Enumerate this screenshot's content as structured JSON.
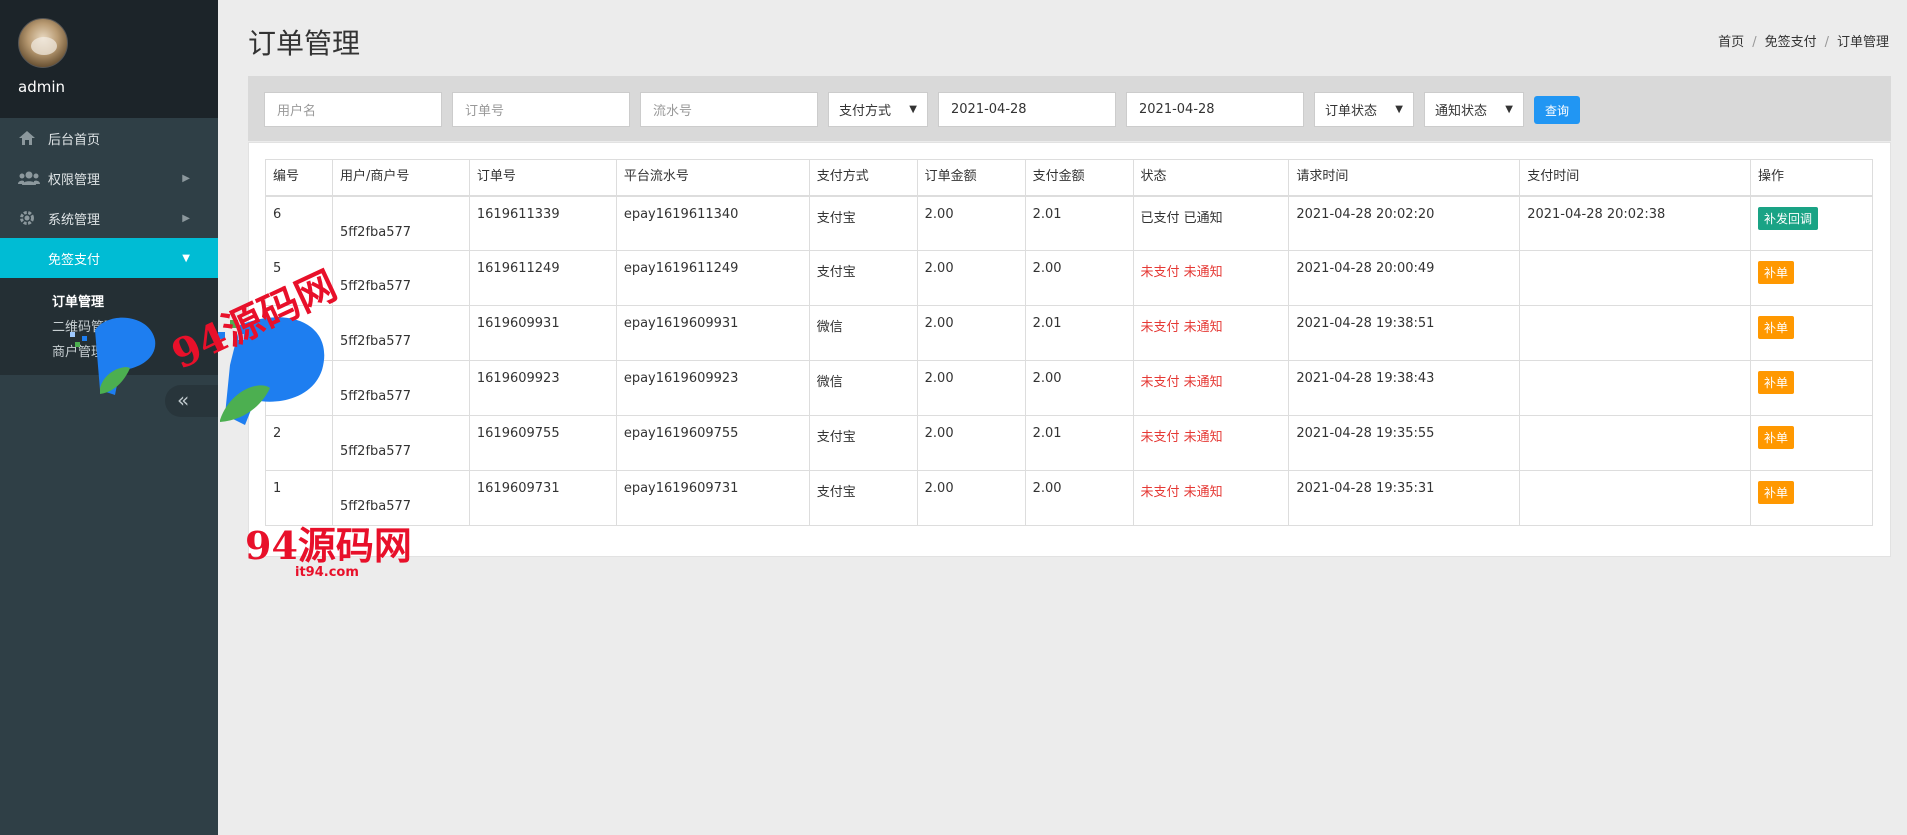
{
  "sidebar": {
    "username": "admin",
    "items": [
      {
        "label": "后台首页",
        "icon": "home-icon"
      },
      {
        "label": "权限管理",
        "icon": "users-icon"
      },
      {
        "label": "系统管理",
        "icon": "gear-icon"
      },
      {
        "label": "免签支付",
        "icon": "none"
      }
    ],
    "subitems": [
      "订单管理",
      "二维码管理",
      "商户管理"
    ]
  },
  "page": {
    "title": "订单管理",
    "breadcrumb": [
      "首页",
      "免签支付",
      "订单管理"
    ]
  },
  "filters": {
    "username_placeholder": "用户名",
    "order_no_placeholder": "订单号",
    "serial_placeholder": "流水号",
    "pay_method": "支付方式",
    "date_start": "2021-04-28",
    "date_end": "2021-04-28",
    "order_status": "订单状态",
    "notify_status": "通知状态",
    "query_label": "查询"
  },
  "table": {
    "headers": [
      "编号",
      "用户/商户号",
      "订单号",
      "平台流水号",
      "支付方式",
      "订单金额",
      "支付金额",
      "状态",
      "请求时间",
      "支付时间",
      "操作"
    ],
    "rows": [
      {
        "id": "6",
        "merchant": "5ff2fba577",
        "order_no": "1619611339",
        "serial": "epay1619611340",
        "method": "支付宝",
        "order_amount": "2.00",
        "pay_amount": "2.01",
        "status": "已支付 已通知",
        "paid": true,
        "request_time": "2021-04-28 20:02:20",
        "pay_time": "2021-04-28 20:02:38",
        "action": "补发回调"
      },
      {
        "id": "5",
        "merchant": "5ff2fba577",
        "order_no": "1619611249",
        "serial": "epay1619611249",
        "method": "支付宝",
        "order_amount": "2.00",
        "pay_amount": "2.00",
        "status": "未支付 未通知",
        "paid": false,
        "request_time": "2021-04-28 20:00:49",
        "pay_time": "",
        "action": "补单"
      },
      {
        "id": "4",
        "merchant": "5ff2fba577",
        "order_no": "1619609931",
        "serial": "epay1619609931",
        "method": "微信",
        "order_amount": "2.00",
        "pay_amount": "2.01",
        "status": "未支付 未通知",
        "paid": false,
        "request_time": "2021-04-28 19:38:51",
        "pay_time": "",
        "action": "补单"
      },
      {
        "id": "3",
        "merchant": "5ff2fba577",
        "order_no": "1619609923",
        "serial": "epay1619609923",
        "method": "微信",
        "order_amount": "2.00",
        "pay_amount": "2.00",
        "status": "未支付 未通知",
        "paid": false,
        "request_time": "2021-04-28 19:38:43",
        "pay_time": "",
        "action": "补单"
      },
      {
        "id": "2",
        "merchant": "5ff2fba577",
        "order_no": "1619609755",
        "serial": "epay1619609755",
        "method": "支付宝",
        "order_amount": "2.00",
        "pay_amount": "2.01",
        "status": "未支付 未通知",
        "paid": false,
        "request_time": "2021-04-28 19:35:55",
        "pay_time": "",
        "action": "补单"
      },
      {
        "id": "1",
        "merchant": "5ff2fba577",
        "order_no": "1619609731",
        "serial": "epay1619609731",
        "method": "支付宝",
        "order_amount": "2.00",
        "pay_amount": "2.00",
        "status": "未支付 未通知",
        "paid": false,
        "request_time": "2021-04-28 19:35:31",
        "pay_time": "",
        "action": "补单"
      }
    ]
  },
  "watermark": {
    "text_top": "94源码网",
    "text_bottom": "94源码网",
    "domain": "it94.com"
  },
  "colors": {
    "accent": "#00bcd4",
    "query_button": "#2196f3",
    "callback_button": "#1aa385",
    "supplement_button": "#ff9800",
    "unpaid_status": "#e53935"
  }
}
